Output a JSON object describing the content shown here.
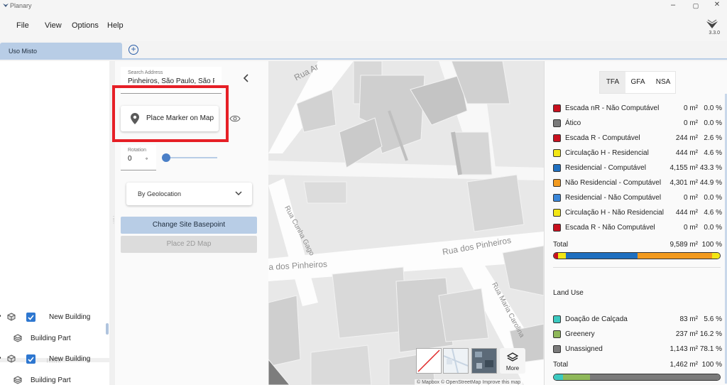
{
  "window": {
    "title": "Planary",
    "minimize": "–",
    "maximize": "▢",
    "close": "✕"
  },
  "menu": {
    "file": "File",
    "view": "View",
    "options": "Options",
    "help": "Help",
    "version": "3.3.0"
  },
  "tabs": {
    "active": "Uso Misto",
    "add": "+"
  },
  "tree": [
    {
      "label": "New Building",
      "checked": true
    },
    {
      "label": "Building Part"
    },
    {
      "label": "New Building",
      "checked": true
    },
    {
      "label": "Building Part"
    }
  ],
  "tools": {
    "search_label": "Search Address",
    "search_value": "Pinheiros, São Paulo, São P",
    "place_marker": "Place Marker on Map",
    "rotation_label": "Rotation",
    "rotation_value": "0",
    "rotation_unit": "°",
    "rotation_level": 0,
    "geolocation": "By Geolocation",
    "change_basepoint": "Change Site Basepoint",
    "place_2d_map": "Place 2D Map"
  },
  "map": {
    "streets": [
      "Rua Ar",
      "Rua Cunha Gago",
      "Rua dos Pinheiros",
      "a dos Pinheiros",
      "Rua Maria Carolina"
    ],
    "more_label": "More",
    "attribution": "© Mapbox © OpenStreetMap Improve this map"
  },
  "metrics": {
    "tabs": [
      "TFA",
      "GFA",
      "NSA"
    ],
    "active_tab": "TFA",
    "program": [
      {
        "name": "Escada nR - Não Computável",
        "area": "0 m²",
        "pct": "0.0 %",
        "color": "#c8101e"
      },
      {
        "name": "Ático",
        "area": "0 m²",
        "pct": "0.0 %",
        "color": "#7a7a7a"
      },
      {
        "name": "Escada R - Computável",
        "area": "244 m²",
        "pct": "2.6 %",
        "color": "#c8101e"
      },
      {
        "name": "Circulação H - Residencial",
        "area": "444 m²",
        "pct": "4.6 %",
        "color": "#f2e614"
      },
      {
        "name": "Residencial - Computável",
        "area": "4,155 m²",
        "pct": "43.3 %",
        "color": "#1f6fbf"
      },
      {
        "name": "Não Residencial - Computável",
        "area": "4,301 m²",
        "pct": "44.9 %",
        "color": "#f29a1f"
      },
      {
        "name": "Residencial - Não Computável",
        "area": "0 m²",
        "pct": "0.0 %",
        "color": "#3a86d8"
      },
      {
        "name": "Circulação H - Não Residencial",
        "area": "444 m²",
        "pct": "4.6 %",
        "color": "#f2e614"
      },
      {
        "name": "Escada R - Não Computável",
        "area": "0 m²",
        "pct": "0.0 %",
        "color": "#c8101e"
      }
    ],
    "program_total": {
      "name": "Total",
      "area": "9,589 m²",
      "pct": "100 %"
    },
    "program_bar": [
      {
        "color": "#c8101e",
        "pct": 2.6
      },
      {
        "color": "#f2e614",
        "pct": 4.6
      },
      {
        "color": "#1f6fbf",
        "pct": 43.3
      },
      {
        "color": "#f29a1f",
        "pct": 44.9
      },
      {
        "color": "#f2e614",
        "pct": 4.6
      }
    ],
    "land_use_title": "Land Use",
    "land_use": [
      {
        "name": "Doação de Calçada",
        "area": "83 m²",
        "pct": "5.6 %",
        "color": "#3cc9c0"
      },
      {
        "name": "Greenery",
        "area": "237 m²",
        "pct": "16.2 %",
        "color": "#8fb85a"
      },
      {
        "name": "Unassigned",
        "area": "1,143 m²",
        "pct": "78.1 %",
        "color": "#7a7a7a"
      }
    ],
    "land_total": {
      "name": "Total",
      "area": "1,462 m²",
      "pct": "100 %"
    },
    "land_bar": [
      {
        "color": "#3cc9c0",
        "pct": 5.6
      },
      {
        "color": "#8fb85a",
        "pct": 16.2
      },
      {
        "color": "#7a7a7a",
        "pct": 78.1
      }
    ]
  }
}
